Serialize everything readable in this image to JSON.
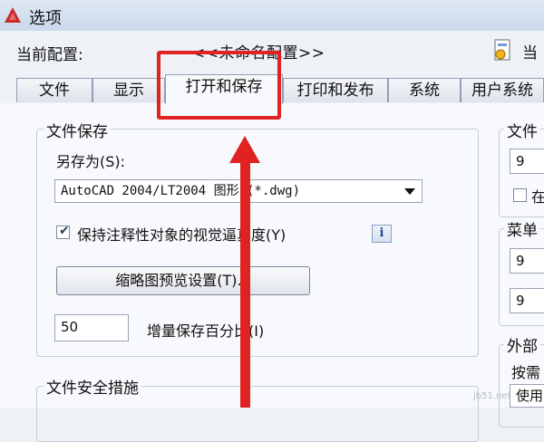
{
  "window": {
    "title": "选项"
  },
  "config": {
    "label": "当前配置:",
    "value": "<<未命名配置>>",
    "cut_text": "当"
  },
  "tabs": [
    {
      "label": "文件"
    },
    {
      "label": "显示"
    },
    {
      "label": "打开和保存",
      "active": true
    },
    {
      "label": "打印和发布"
    },
    {
      "label": "系统"
    },
    {
      "label": "用户系统"
    }
  ],
  "file_save": {
    "title": "文件保存",
    "save_as_label": "另存为(S):",
    "save_as_value": "AutoCAD 2004/LT2004 图形 (*.dwg)",
    "keep_annotative_label": "保持注释性对象的视觉逼真度(Y)",
    "keep_annotative_checked": true,
    "info_icon_glyph": "i",
    "thumbnail_button": "缩略图预览设置(T)...",
    "incremental_value": "50",
    "incremental_label": "增量保存百分比(I)"
  },
  "file_security": {
    "title": "文件安全措施"
  },
  "right_panel": {
    "group1_title": "文件",
    "group1_value": "9",
    "group2_title": "菜单",
    "group2_value1": "9",
    "group2_value2": "9",
    "group3_title": "外部",
    "group3_label": "按需",
    "group3_cut": "使用"
  },
  "watermark": "jb51.net",
  "annotation_color": "#e02222"
}
